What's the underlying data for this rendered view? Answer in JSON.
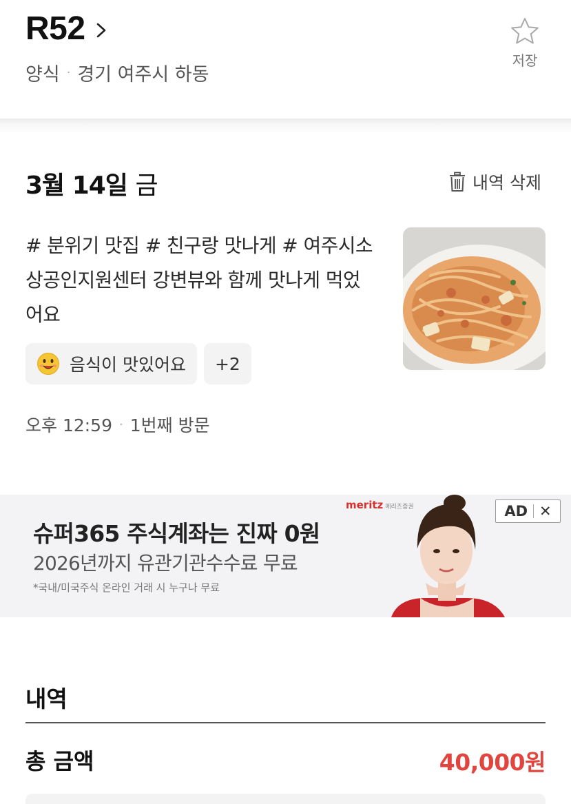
{
  "header": {
    "place_name": "R52",
    "category": "양식",
    "location": "경기 여주시 하동",
    "save_label": "저장"
  },
  "visit": {
    "date": "3월 14일",
    "weekday": "금",
    "delete_label": "내역 삭제",
    "review_text": "# 분위기 맛집 # 친구랑 맛나게 # 여주시소상공인지원센터 강변뷰와 함께 맛나게 먹었어요",
    "chip_label": "음식이 맛있어요",
    "chip_more": "+2",
    "time": "오후 12:59",
    "visit_count": "1번째 방문"
  },
  "ad": {
    "headline": "슈퍼365 주식계좌는 진짜 0원",
    "subline": "2026년까지 유관기관수수료 무료",
    "fine_print": "*국내/미국주식 온라인 거래 시 누구나 무료",
    "brand": "meritz",
    "brand_sub": "메리츠증권",
    "badge_label": "AD",
    "badge_close": "✕"
  },
  "history": {
    "title": "내역",
    "total_label": "총 금액",
    "total_value": "40,000원"
  },
  "colors": {
    "accent_price": "#e0453f",
    "ad_brand": "#d9302c"
  }
}
